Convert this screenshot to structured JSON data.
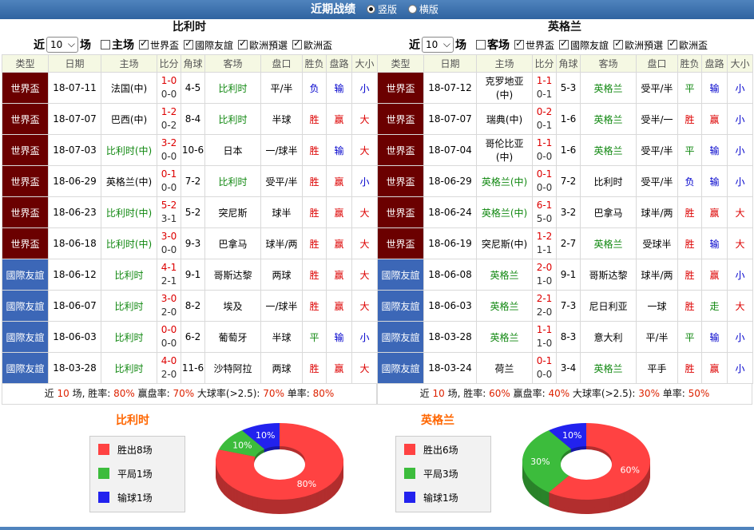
{
  "title": "近期战绩",
  "view_options": [
    "竖版",
    "横版"
  ],
  "colors": {
    "win": "#ff4242",
    "draw": "#3cbc3c",
    "loss": "#2222ee",
    "worldcup": "#6b0000",
    "friendly": "#3c67b7"
  },
  "columns_left": [
    "类型",
    "日期",
    "主场",
    "比分",
    "角球",
    "客场",
    "盘口",
    "胜负",
    "盘路",
    "大小"
  ],
  "columns_right": [
    "类型",
    "日期",
    "主场",
    "比分",
    "角球",
    "客场",
    "盘口",
    "胜负",
    "盘路",
    "大小"
  ],
  "left": {
    "team": "比利时",
    "filter": {
      "near": "近",
      "count": "10",
      "unit": "场",
      "venue": "主场",
      "c1": "世界盃",
      "c2": "國際友誼",
      "c3": "歐洲預選",
      "c4": "歐洲盃"
    },
    "rows": [
      {
        "type": "世界盃",
        "kind": "wc",
        "date": "18-07-11",
        "home": "法国(中)",
        "hc": "",
        "ft": "1-0",
        "ht": "0-0",
        "corner": "4-5",
        "away": "比利时",
        "ac": "green",
        "hcap": "平/半",
        "res": "负",
        "rc": "blue",
        "pan": "输",
        "pc": "blue",
        "ou": "小",
        "oc": "blue"
      },
      {
        "type": "世界盃",
        "kind": "wc",
        "date": "18-07-07",
        "home": "巴西(中)",
        "hc": "",
        "ft": "1-2",
        "ht": "0-2",
        "corner": "8-4",
        "away": "比利时",
        "ac": "green",
        "hcap": "半球",
        "res": "胜",
        "rc": "red",
        "pan": "赢",
        "pc": "red",
        "ou": "大",
        "oc": "red"
      },
      {
        "type": "世界盃",
        "kind": "wc",
        "date": "18-07-03",
        "home": "比利时(中)",
        "hc": "green",
        "ft": "3-2",
        "ht": "0-0",
        "corner": "10-6",
        "away": "日本",
        "ac": "",
        "hcap": "一/球半",
        "res": "胜",
        "rc": "red",
        "pan": "输",
        "pc": "blue",
        "ou": "大",
        "oc": "red"
      },
      {
        "type": "世界盃",
        "kind": "wc",
        "date": "18-06-29",
        "home": "英格兰(中)",
        "hc": "",
        "ft": "0-1",
        "ht": "0-0",
        "corner": "7-2",
        "away": "比利时",
        "ac": "green",
        "hcap": "受平/半",
        "res": "胜",
        "rc": "red",
        "pan": "赢",
        "pc": "red",
        "ou": "小",
        "oc": "blue"
      },
      {
        "type": "世界盃",
        "kind": "wc",
        "date": "18-06-23",
        "home": "比利时(中)",
        "hc": "green",
        "ft": "5-2",
        "ht": "3-1",
        "corner": "5-2",
        "away": "突尼斯",
        "ac": "",
        "hcap": "球半",
        "res": "胜",
        "rc": "red",
        "pan": "赢",
        "pc": "red",
        "ou": "大",
        "oc": "red"
      },
      {
        "type": "世界盃",
        "kind": "wc",
        "date": "18-06-18",
        "home": "比利时(中)",
        "hc": "green",
        "ft": "3-0",
        "ht": "0-0",
        "corner": "9-3",
        "away": "巴拿马",
        "ac": "",
        "hcap": "球半/两",
        "res": "胜",
        "rc": "red",
        "pan": "赢",
        "pc": "red",
        "ou": "大",
        "oc": "red"
      },
      {
        "type": "國際友誼",
        "kind": "fr",
        "date": "18-06-12",
        "home": "比利时",
        "hc": "green",
        "ft": "4-1",
        "ht": "2-1",
        "corner": "9-1",
        "away": "哥斯达黎",
        "ac": "",
        "hcap": "两球",
        "res": "胜",
        "rc": "red",
        "pan": "赢",
        "pc": "red",
        "ou": "大",
        "oc": "red"
      },
      {
        "type": "國際友誼",
        "kind": "fr",
        "date": "18-06-07",
        "home": "比利时",
        "hc": "green",
        "ft": "3-0",
        "ht": "2-0",
        "corner": "8-2",
        "away": "埃及",
        "ac": "",
        "hcap": "一/球半",
        "res": "胜",
        "rc": "red",
        "pan": "赢",
        "pc": "red",
        "ou": "大",
        "oc": "red"
      },
      {
        "type": "國際友誼",
        "kind": "fr",
        "date": "18-06-03",
        "home": "比利时",
        "hc": "green",
        "ft": "0-0",
        "ht": "0-0",
        "corner": "6-2",
        "away": "葡萄牙",
        "ac": "",
        "hcap": "半球",
        "res": "平",
        "rc": "green",
        "pan": "输",
        "pc": "blue",
        "ou": "小",
        "oc": "blue"
      },
      {
        "type": "國際友誼",
        "kind": "fr",
        "date": "18-03-28",
        "home": "比利时",
        "hc": "green",
        "ft": "4-0",
        "ht": "2-0",
        "corner": "11-6",
        "away": "沙特阿拉",
        "ac": "",
        "hcap": "两球",
        "res": "胜",
        "rc": "red",
        "pan": "赢",
        "pc": "red",
        "ou": "大",
        "oc": "red"
      }
    ],
    "summary": {
      "p1": "近 ",
      "n": "10",
      "p2": " 场, 胜率: ",
      "win": "80%",
      "p3": " 赢盘率: ",
      "pan": "70%",
      "p4": " 大球率(>2.5): ",
      "big": "70%",
      "p5": " 单率: ",
      "odd": "80%"
    },
    "chart": {
      "title": "比利时",
      "legend": [
        "胜出8场",
        "平局1场",
        "输球1场"
      ],
      "values": [
        80,
        10,
        10
      ],
      "labels": [
        "80%",
        "10%",
        "10%"
      ]
    }
  },
  "right": {
    "team": "英格兰",
    "filter": {
      "near": "近",
      "count": "10",
      "unit": "场",
      "venue": "客场",
      "c1": "世界盃",
      "c2": "國際友誼",
      "c3": "歐洲預選",
      "c4": "歐洲盃"
    },
    "rows": [
      {
        "type": "世界盃",
        "kind": "wc",
        "date": "18-07-12",
        "home": "克罗地亚(中)",
        "hc": "",
        "ft": "1-1",
        "ht": "0-1",
        "corner": "5-3",
        "away": "英格兰",
        "ac": "green",
        "hcap": "受平/半",
        "res": "平",
        "rc": "green",
        "pan": "输",
        "pc": "blue",
        "ou": "小",
        "oc": "blue"
      },
      {
        "type": "世界盃",
        "kind": "wc",
        "date": "18-07-07",
        "home": "瑞典(中)",
        "hc": "",
        "ft": "0-2",
        "ht": "0-1",
        "corner": "1-6",
        "away": "英格兰",
        "ac": "green",
        "hcap": "受半/一",
        "res": "胜",
        "rc": "red",
        "pan": "赢",
        "pc": "red",
        "ou": "小",
        "oc": "blue"
      },
      {
        "type": "世界盃",
        "kind": "wc",
        "date": "18-07-04",
        "home": "哥伦比亚(中)",
        "hc": "",
        "ft": "1-1",
        "ht": "0-0",
        "corner": "1-6",
        "away": "英格兰",
        "ac": "green",
        "hcap": "受平/半",
        "res": "平",
        "rc": "green",
        "pan": "输",
        "pc": "blue",
        "ou": "小",
        "oc": "blue"
      },
      {
        "type": "世界盃",
        "kind": "wc",
        "date": "18-06-29",
        "home": "英格兰(中)",
        "hc": "green",
        "ft": "0-1",
        "ht": "0-0",
        "corner": "7-2",
        "away": "比利时",
        "ac": "",
        "hcap": "受平/半",
        "res": "负",
        "rc": "blue",
        "pan": "输",
        "pc": "blue",
        "ou": "小",
        "oc": "blue"
      },
      {
        "type": "世界盃",
        "kind": "wc",
        "date": "18-06-24",
        "home": "英格兰(中)",
        "hc": "green",
        "ft": "6-1",
        "ht": "5-0",
        "corner": "3-2",
        "away": "巴拿马",
        "ac": "",
        "hcap": "球半/两",
        "res": "胜",
        "rc": "red",
        "pan": "赢",
        "pc": "red",
        "ou": "大",
        "oc": "red"
      },
      {
        "type": "世界盃",
        "kind": "wc",
        "date": "18-06-19",
        "home": "突尼斯(中)",
        "hc": "",
        "ft": "1-2",
        "ht": "1-1",
        "corner": "2-7",
        "away": "英格兰",
        "ac": "green",
        "hcap": "受球半",
        "res": "胜",
        "rc": "red",
        "pan": "输",
        "pc": "blue",
        "ou": "大",
        "oc": "red"
      },
      {
        "type": "國際友誼",
        "kind": "fr",
        "date": "18-06-08",
        "home": "英格兰",
        "hc": "green",
        "ft": "2-0",
        "ht": "1-0",
        "corner": "9-1",
        "away": "哥斯达黎",
        "ac": "",
        "hcap": "球半/两",
        "res": "胜",
        "rc": "red",
        "pan": "赢",
        "pc": "red",
        "ou": "小",
        "oc": "blue"
      },
      {
        "type": "國際友誼",
        "kind": "fr",
        "date": "18-06-03",
        "home": "英格兰",
        "hc": "green",
        "ft": "2-1",
        "ht": "2-0",
        "corner": "7-3",
        "away": "尼日利亚",
        "ac": "",
        "hcap": "一球",
        "res": "胜",
        "rc": "red",
        "pan": "走",
        "pc": "green",
        "ou": "大",
        "oc": "red"
      },
      {
        "type": "國際友誼",
        "kind": "fr",
        "date": "18-03-28",
        "home": "英格兰",
        "hc": "green",
        "ft": "1-1",
        "ht": "1-0",
        "corner": "8-3",
        "away": "意大利",
        "ac": "",
        "hcap": "平/半",
        "res": "平",
        "rc": "green",
        "pan": "输",
        "pc": "blue",
        "ou": "小",
        "oc": "blue"
      },
      {
        "type": "國際友誼",
        "kind": "fr",
        "date": "18-03-24",
        "home": "荷兰",
        "hc": "",
        "ft": "0-1",
        "ht": "0-0",
        "corner": "3-4",
        "away": "英格兰",
        "ac": "green",
        "hcap": "平手",
        "res": "胜",
        "rc": "red",
        "pan": "赢",
        "pc": "red",
        "ou": "小",
        "oc": "blue"
      }
    ],
    "summary": {
      "p1": "近 ",
      "n": "10",
      "p2": " 场, 胜率: ",
      "win": "60%",
      "p3": " 赢盘率: ",
      "pan": "40%",
      "p4": " 大球率(>2.5): ",
      "big": "30%",
      "p5": " 单率: ",
      "odd": "50%"
    },
    "chart": {
      "title": "英格兰",
      "legend": [
        "胜出6场",
        "平局3场",
        "输球1场"
      ],
      "values": [
        60,
        30,
        10
      ],
      "labels": [
        "60%",
        "30%",
        "10%"
      ]
    }
  }
}
